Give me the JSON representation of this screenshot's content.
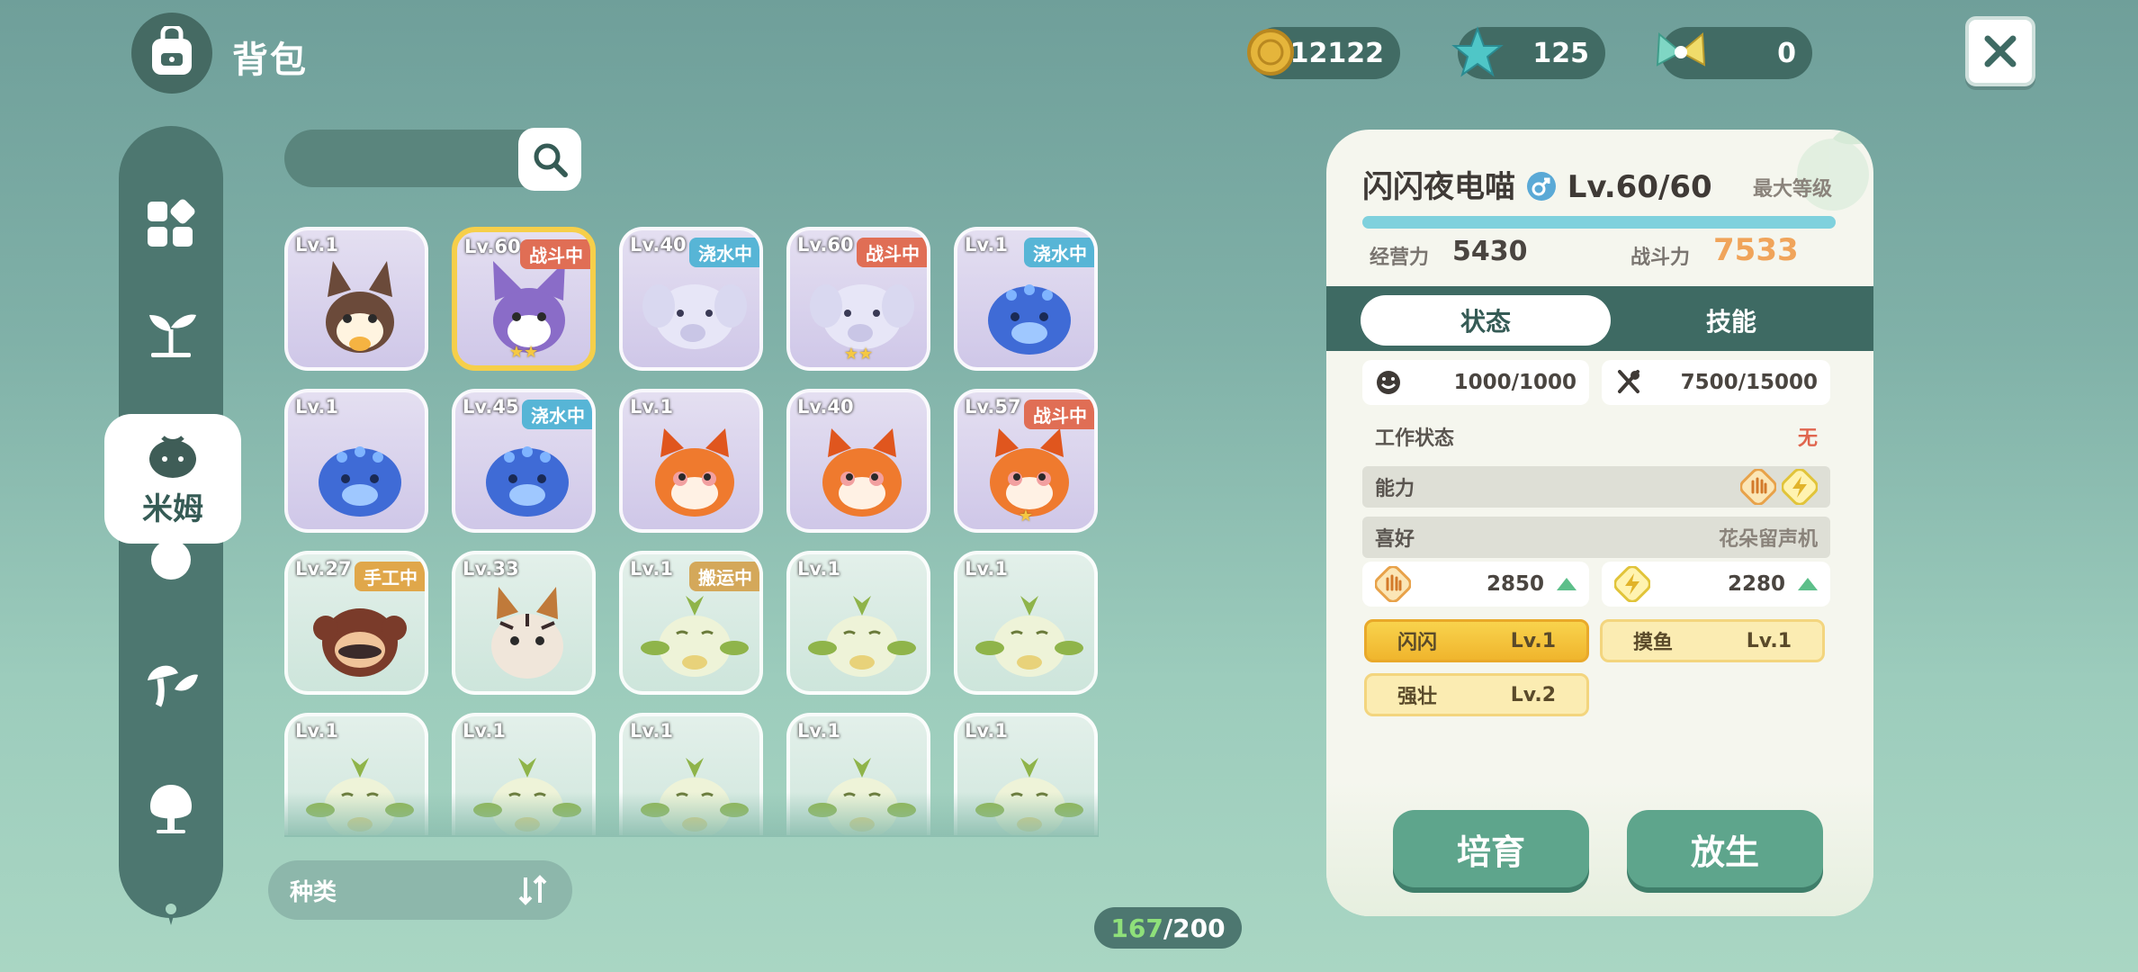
{
  "header": {
    "title": "背包"
  },
  "currency": {
    "coins": "12122",
    "gems": "125",
    "tickets": "0"
  },
  "sidebar": {
    "active_label": "米姆"
  },
  "grid": {
    "items": [
      {
        "level": "Lv.1",
        "tag": "",
        "tag_type": "",
        "stars": "",
        "theme": "purple",
        "creature": "fox",
        "selected": false
      },
      {
        "level": "Lv.60",
        "tag": "战斗中",
        "tag_type": "fight",
        "stars": "★★",
        "theme": "purple",
        "creature": "cat",
        "selected": true
      },
      {
        "level": "Lv.40",
        "tag": "浇水中",
        "tag_type": "water",
        "stars": "",
        "theme": "purple",
        "creature": "elephant",
        "selected": false
      },
      {
        "level": "Lv.60",
        "tag": "战斗中",
        "tag_type": "fight",
        "stars": "★★",
        "theme": "purple",
        "creature": "elephant",
        "selected": false
      },
      {
        "level": "Lv.1",
        "tag": "浇水中",
        "tag_type": "water",
        "stars": "",
        "theme": "purple",
        "creature": "blob",
        "selected": false
      },
      {
        "level": "Lv.1",
        "tag": "",
        "tag_type": "",
        "stars": "",
        "theme": "purple",
        "creature": "blob",
        "selected": false
      },
      {
        "level": "Lv.45",
        "tag": "浇水中",
        "tag_type": "water",
        "stars": "",
        "theme": "purple",
        "creature": "blob",
        "selected": false
      },
      {
        "level": "Lv.1",
        "tag": "",
        "tag_type": "",
        "stars": "",
        "theme": "purple",
        "creature": "redpanda",
        "selected": false
      },
      {
        "level": "Lv.40",
        "tag": "",
        "tag_type": "",
        "stars": "",
        "theme": "purple",
        "creature": "redpanda",
        "selected": false
      },
      {
        "level": "Lv.57",
        "tag": "战斗中",
        "tag_type": "fight",
        "stars": "★",
        "theme": "purple",
        "creature": "redpanda",
        "selected": false
      },
      {
        "level": "Lv.27",
        "tag": "手工中",
        "tag_type": "craft",
        "stars": "",
        "theme": "green",
        "creature": "monkey",
        "selected": false
      },
      {
        "level": "Lv.33",
        "tag": "",
        "tag_type": "",
        "stars": "",
        "theme": "green",
        "creature": "tiger",
        "selected": false
      },
      {
        "level": "Lv.1",
        "tag": "搬运中",
        "tag_type": "carry",
        "stars": "",
        "theme": "green",
        "creature": "sprout",
        "selected": false
      },
      {
        "level": "Lv.1",
        "tag": "",
        "tag_type": "",
        "stars": "",
        "theme": "green",
        "creature": "sprout",
        "selected": false
      },
      {
        "level": "Lv.1",
        "tag": "",
        "tag_type": "",
        "stars": "",
        "theme": "green",
        "creature": "sprout",
        "selected": false
      },
      {
        "level": "Lv.1",
        "tag": "",
        "tag_type": "",
        "stars": "",
        "theme": "green",
        "creature": "sprout",
        "selected": false
      },
      {
        "level": "Lv.1",
        "tag": "",
        "tag_type": "",
        "stars": "",
        "theme": "green",
        "creature": "sprout",
        "selected": false
      },
      {
        "level": "Lv.1",
        "tag": "",
        "tag_type": "",
        "stars": "",
        "theme": "green",
        "creature": "sprout",
        "selected": false
      },
      {
        "level": "Lv.1",
        "tag": "",
        "tag_type": "",
        "stars": "",
        "theme": "green",
        "creature": "sprout",
        "selected": false
      },
      {
        "level": "Lv.1",
        "tag": "",
        "tag_type": "",
        "stars": "",
        "theme": "green",
        "creature": "sprout",
        "selected": false
      }
    ]
  },
  "sort": {
    "label": "种类"
  },
  "capacity": {
    "current": "167",
    "total": "/200"
  },
  "detail": {
    "name": "闪闪夜电喵",
    "gender_icon": "male-icon",
    "level": "Lv.60/60",
    "max_label": "最大等级",
    "xp_fraction": 1.0,
    "management_label": "经营力",
    "management_value": "5430",
    "combat_label": "战斗力",
    "combat_value": "7533",
    "tabs": [
      "状态",
      "技能"
    ],
    "mood": "1000/1000",
    "food": "7500/15000",
    "work_status_label": "工作状态",
    "work_status_value": "无",
    "ability_label": "能力",
    "ability_icons": [
      {
        "icon": "hand-icon",
        "level": "4"
      },
      {
        "icon": "lightning-icon",
        "level": "2"
      }
    ],
    "preference_label": "喜好",
    "preference_value": "花朵留声机",
    "work_stats": [
      {
        "icon": "hand-icon",
        "level": "4",
        "value": "2850"
      },
      {
        "icon": "lightning-icon",
        "level": "2",
        "value": "2280"
      }
    ],
    "traits": [
      {
        "name": "闪闪",
        "level": "Lv.1"
      },
      {
        "name": "摸鱼",
        "level": "Lv.1"
      },
      {
        "name": "强壮",
        "level": "Lv.2"
      }
    ],
    "nurture_button": "培育",
    "release_button": "放生"
  },
  "colors": {
    "accent_green": "#5ea58c",
    "combat_orange": "#f0a45a",
    "selected_gold": "#f6cf4a"
  }
}
